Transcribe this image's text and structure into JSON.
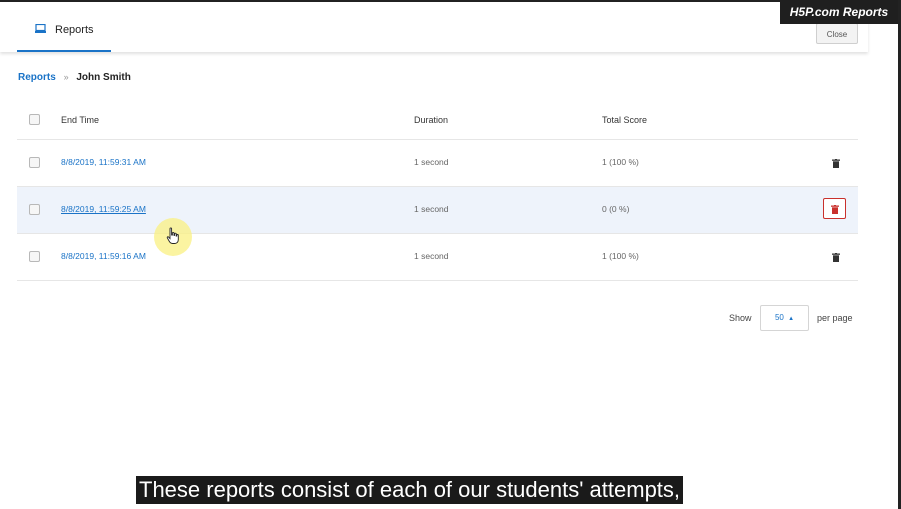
{
  "header": {
    "tab_label": "Reports",
    "close_label": "Close",
    "brand": "H5P.com Reports"
  },
  "breadcrumb": {
    "root": "Reports",
    "separator": "»",
    "current": "John Smith"
  },
  "table": {
    "columns": [
      "End Time",
      "Duration",
      "Total Score"
    ],
    "rows": [
      {
        "end_time": "8/8/2019, 11:59:31 AM",
        "duration": "1 second",
        "score": "1 (100 %)"
      },
      {
        "end_time": "8/8/2019, 11:59:25 AM",
        "duration": "1 second",
        "score": "0 (0 %)"
      },
      {
        "end_time": "8/8/2019, 11:59:16 AM",
        "duration": "1 second",
        "score": "1 (100 %)"
      }
    ]
  },
  "pagination": {
    "show_label": "Show",
    "per_page_value": "50",
    "per_page_label": "per page"
  },
  "caption": "These reports consist of each of our students' attempts,",
  "colors": {
    "accent": "#1a73c7",
    "delete_outline": "#c9302c",
    "row_hover": "#eef3fb"
  }
}
